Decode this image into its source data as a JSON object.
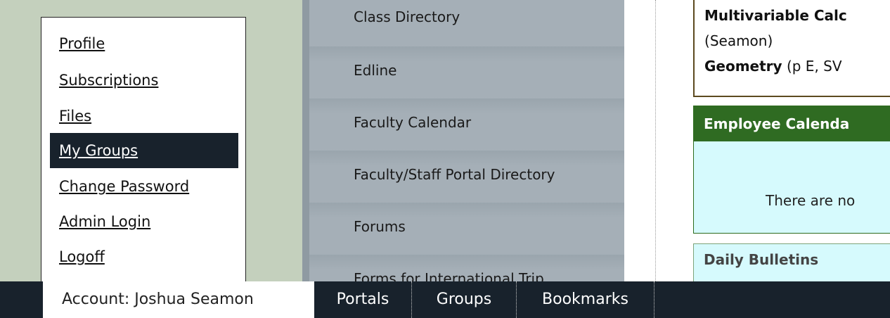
{
  "account_menu": {
    "items": [
      {
        "label": "Profile",
        "active": false
      },
      {
        "label": "Subscriptions",
        "active": false
      },
      {
        "label": "Files",
        "active": false
      },
      {
        "label": "My Groups",
        "active": true
      },
      {
        "label": "Change Password",
        "active": false
      },
      {
        "label": "Admin Login",
        "active": false
      },
      {
        "label": "Logoff",
        "active": false
      }
    ]
  },
  "portals": {
    "items": [
      {
        "label": "Class Directory"
      },
      {
        "label": "Edline"
      },
      {
        "label": "Faculty Calendar"
      },
      {
        "label": "Faculty/Staff Portal Directory"
      },
      {
        "label": "Forums"
      },
      {
        "label": "Forms for International Trip"
      }
    ]
  },
  "courses": {
    "line1_course": "Multivariable Calc",
    "line2_open": "(",
    "line2_teacher": "Seamon",
    "line2_close": ")",
    "line3_course": "Geometry",
    "line3_detail": " (p E, SV"
  },
  "employee_calendar": {
    "title": "Employee Calenda",
    "message": "There are no"
  },
  "daily_bulletins": {
    "title": "Daily Bulletins"
  },
  "tabbar": {
    "account_label": "Account: Joshua Seamon",
    "tabs": [
      {
        "label": "Portals"
      },
      {
        "label": "Groups"
      },
      {
        "label": "Bookmarks"
      }
    ]
  },
  "colors": {
    "sage_bg": "#c4d0bd",
    "dark_navy": "#18222c",
    "slate_column": "#a5afb7",
    "calendar_green": "#2f6b22",
    "calendar_bg": "#d6fafd"
  }
}
